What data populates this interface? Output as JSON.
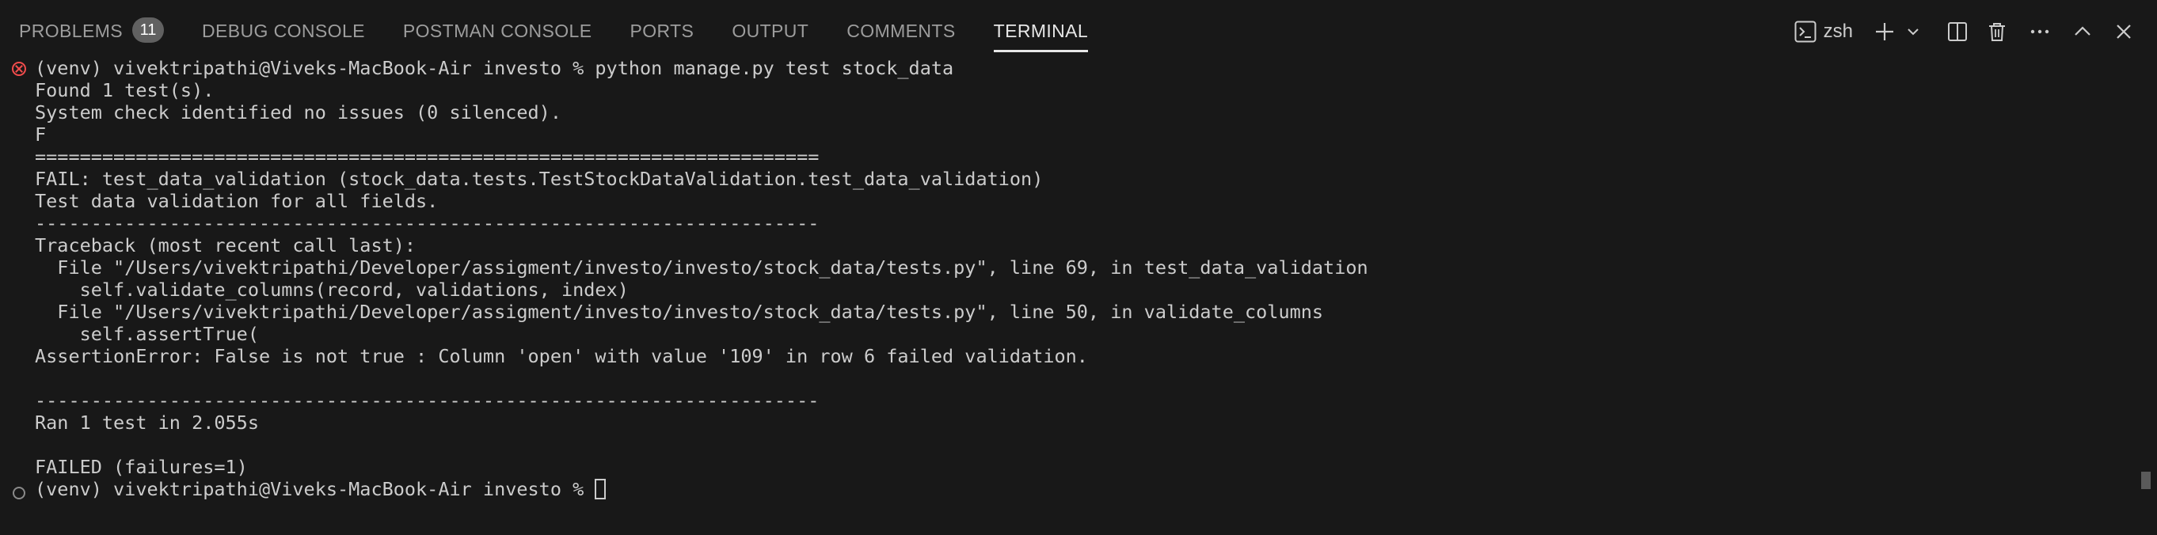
{
  "tabs": [
    {
      "label": "PROBLEMS",
      "badge": "11"
    },
    {
      "label": "DEBUG CONSOLE"
    },
    {
      "label": "POSTMAN CONSOLE"
    },
    {
      "label": "PORTS"
    },
    {
      "label": "OUTPUT"
    },
    {
      "label": "COMMENTS"
    },
    {
      "label": "TERMINAL",
      "active": true
    }
  ],
  "actions": {
    "shell_name": "zsh"
  },
  "terminal": {
    "lines": [
      "(venv) vivektripathi@Viveks-MacBook-Air investo % python manage.py test stock_data",
      "Found 1 test(s).",
      "System check identified no issues (0 silenced).",
      "F",
      "======================================================================",
      "FAIL: test_data_validation (stock_data.tests.TestStockDataValidation.test_data_validation)",
      "Test data validation for all fields.",
      "----------------------------------------------------------------------",
      "Traceback (most recent call last):",
      "  File \"/Users/vivektripathi/Developer/assigment/investo/investo/stock_data/tests.py\", line 69, in test_data_validation",
      "    self.validate_columns(record, validations, index)",
      "  File \"/Users/vivektripathi/Developer/assigment/investo/investo/stock_data/tests.py\", line 50, in validate_columns",
      "    self.assertTrue(",
      "AssertionError: False is not true : Column 'open' with value '109' in row 6 failed validation.",
      "",
      "----------------------------------------------------------------------",
      "Ran 1 test in 2.055s",
      "",
      "FAILED (failures=1)",
      "(venv) vivektripathi@Viveks-MacBook-Air investo % "
    ]
  }
}
